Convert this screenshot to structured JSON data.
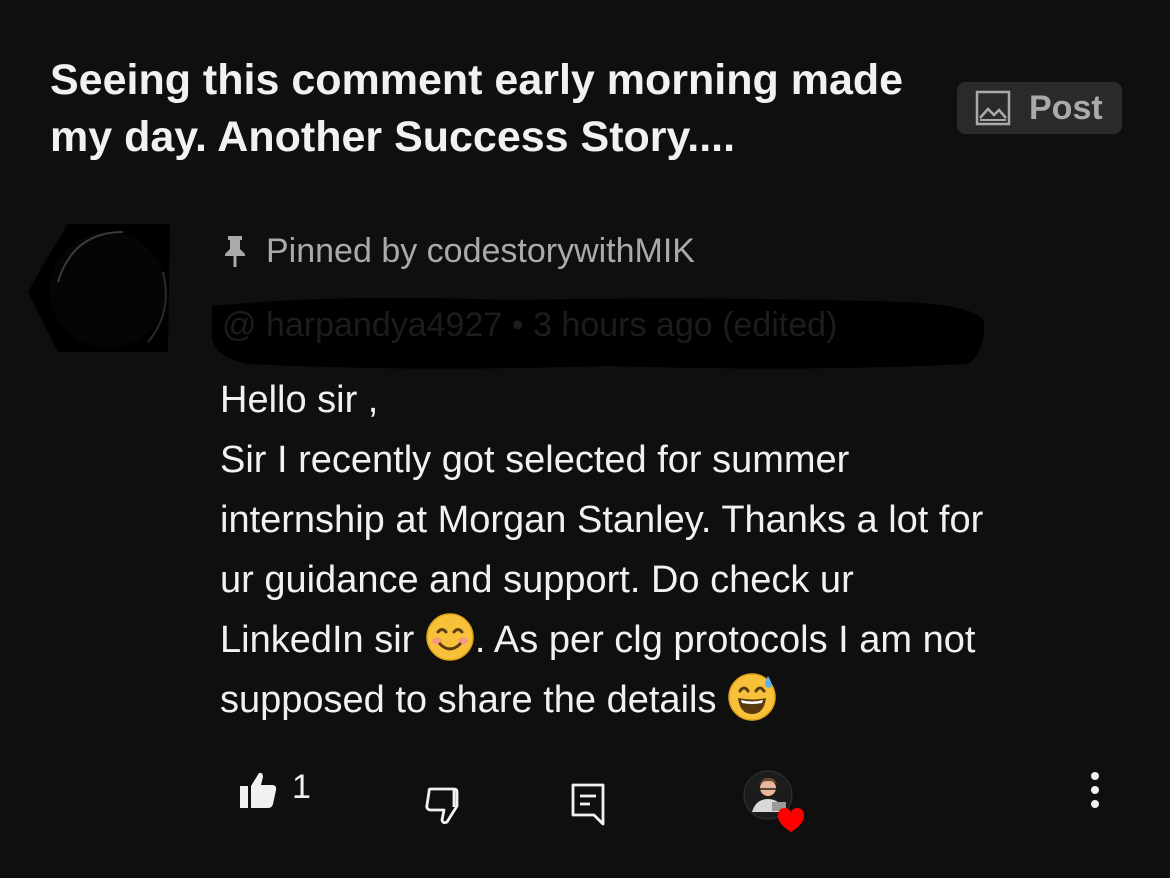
{
  "post": {
    "title": "Seeing this comment early morning made my day. Another Success Story....",
    "chip": {
      "label": "Post",
      "icon": "image-icon"
    }
  },
  "comment": {
    "pinned_text": "Pinned by codestorywithMIK",
    "author_meta": "@      harpandya4927 • 3 hours ago (edited)",
    "lines": [
      "Hello sir ,",
      "Sir I recently got selected for summer",
      "internship at Morgan Stanley. Thanks a lot for",
      "ur guidance and support. Do check ur"
    ],
    "line5_before_emoji": "LinkedIn sir ",
    "line5_after_emoji": ". As per clg protocols I am not",
    "line6_before_emoji": "supposed to share the details ",
    "emoji_1": "smiling-face-emoji",
    "emoji_2": "grinning-sweat-emoji"
  },
  "actions": {
    "like_count": "1",
    "like_icon": "thumbs-up-icon",
    "dislike_icon": "thumbs-down-icon",
    "reply_icon": "reply-icon",
    "creator_heart_icon": "creator-heart-icon",
    "more_icon": "more-vertical-icon"
  },
  "colors": {
    "background": "#0f0f0f",
    "text_primary": "#f1f1f1",
    "text_secondary": "#aaaaaa",
    "chip_background": "#2a2a2a",
    "heart": "#ff0000"
  }
}
